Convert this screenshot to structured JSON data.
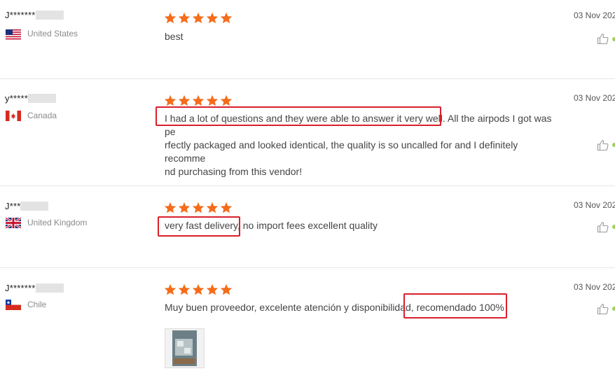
{
  "reviews": [
    {
      "user": "J*******",
      "country": "United States",
      "flag": "us-flag-icon",
      "rating": 5,
      "date": "03 Nov 202",
      "text": "best"
    },
    {
      "user": "y*****",
      "country": "Canada",
      "flag": "ca-flag-icon",
      "rating": 5,
      "date": "03 Nov 202",
      "text_lines": [
        "I had a lot of questions and they were able to answer it very well. All the airpods I got was pe",
        "rfectly packaged and looked identical, the quality is so uncalled for and I definitely recomme",
        "nd purchasing from this vendor!"
      ]
    },
    {
      "user": "J***",
      "country": "United Kingdom",
      "flag": "gb-flag-icon",
      "rating": 5,
      "date": "03 Nov 202",
      "text": "very fast delivery, no import fees excellent quality"
    },
    {
      "user": "J*******",
      "country": "Chile",
      "flag": "cl-flag-icon",
      "rating": 5,
      "date": "03 Nov 202",
      "text": "Muy buen proveedor, excelente atención y disponibilidad, recomendado 100%",
      "has_photo": true
    }
  ],
  "colors": {
    "star": "#f56c1a",
    "highlight": "#d9202a",
    "separator": "#e6e6e6",
    "like_dot": "#9cd35a"
  }
}
